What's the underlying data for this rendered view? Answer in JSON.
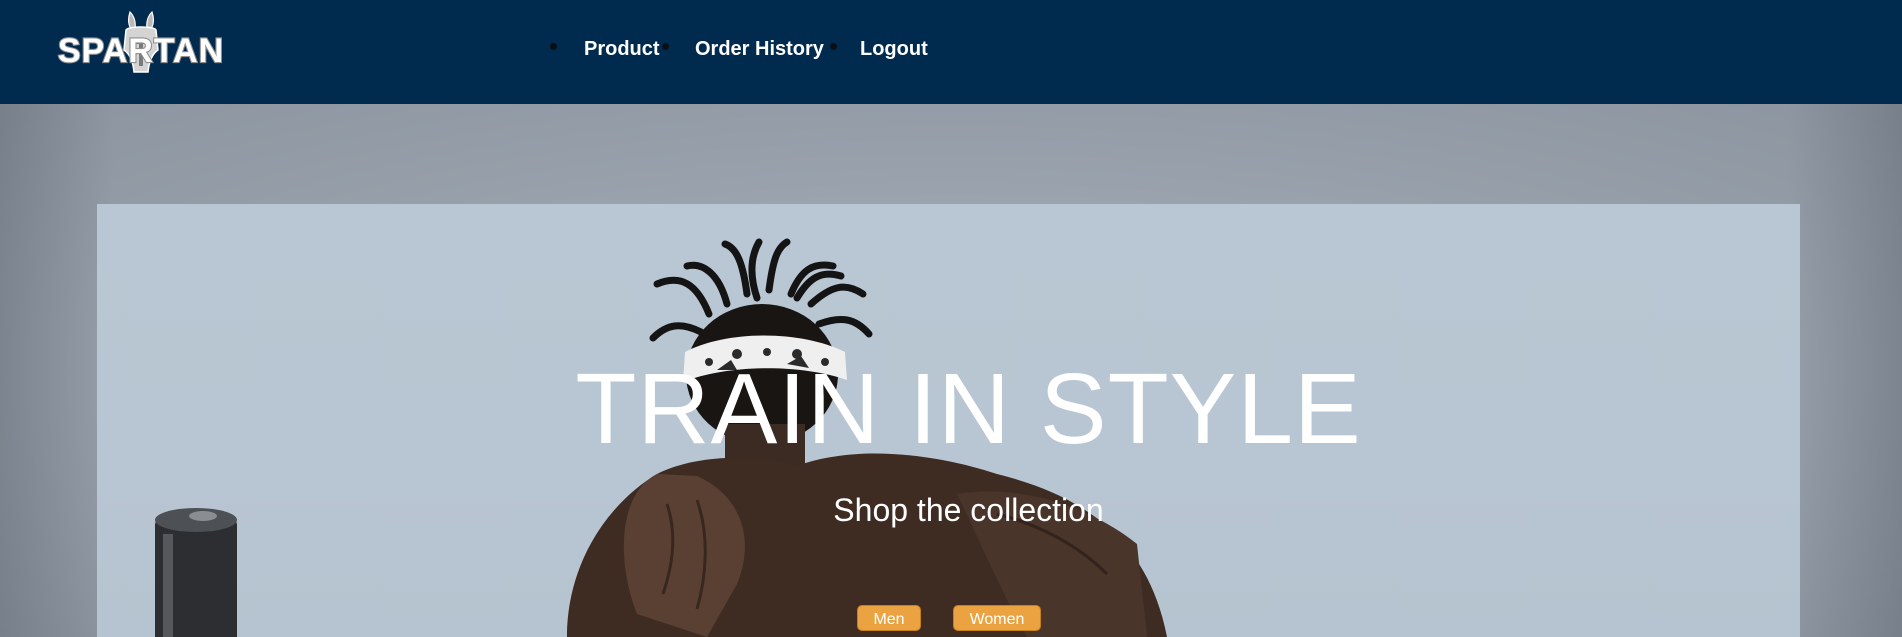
{
  "navbar": {
    "logo_text": "SPARTAN",
    "links": [
      {
        "label": "Product"
      },
      {
        "label": "Order History"
      },
      {
        "label": "Logout"
      }
    ]
  },
  "hero": {
    "title": "TRAIN IN STYLE",
    "subtitle": "Shop the collection",
    "buttons": {
      "men": "Men",
      "women": "Women"
    }
  },
  "colors": {
    "navbar_bg": "#012a4f",
    "page_bg": "#969ea8",
    "hero_bg": "#b9c6d3",
    "button_bg": "#eba241",
    "text": "#ffffff"
  },
  "icons": {
    "logo": "spartan-helmet-logo"
  }
}
